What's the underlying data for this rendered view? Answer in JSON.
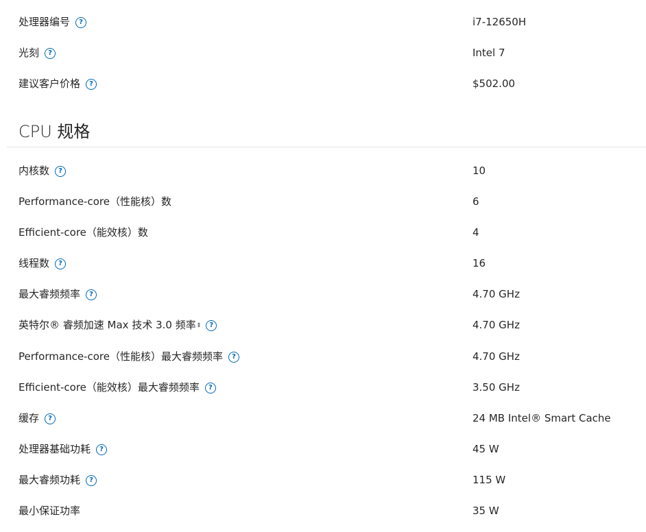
{
  "top_rows": [
    {
      "label": "处理器编号",
      "value": "i7-12650H",
      "help": true
    },
    {
      "label": "光刻",
      "value": "Intel 7",
      "help": true
    },
    {
      "label": "建议客户价格",
      "value": "$502.00",
      "help": true
    }
  ],
  "section": {
    "title": "CPU 规格"
  },
  "spec_rows": [
    {
      "label": "内核数",
      "value": "10",
      "help": true
    },
    {
      "label": "Performance-core（性能核）数",
      "value": "6",
      "help": false
    },
    {
      "label": "Efficient-core（能效核）数",
      "value": "4",
      "help": false
    },
    {
      "label": "线程数",
      "value": "16",
      "help": true
    },
    {
      "label": "最大睿频频率",
      "value": "4.70 GHz",
      "help": true
    },
    {
      "label": "英特尔® 睿频加速 Max 技术 3.0 频率",
      "sup": "‡",
      "value": "4.70 GHz",
      "help": true
    },
    {
      "label": "Performance-core（性能核）最大睿频频率",
      "value": "4.70 GHz",
      "help": true
    },
    {
      "label": "Efficient-core（能效核）最大睿频频率",
      "value": "3.50 GHz",
      "help": true
    },
    {
      "label": "缓存",
      "value": "24 MB Intel® Smart Cache",
      "help": true
    },
    {
      "label": "处理器基础功耗",
      "value": "45 W",
      "help": true
    },
    {
      "label": "最大睿频功耗",
      "value": "115 W",
      "help": true
    },
    {
      "label": "最小保证功率",
      "value": "35 W",
      "help": false
    }
  ],
  "help_glyph": "?",
  "help_icon": "question-circle-icon",
  "accent_color": "#0068b5"
}
